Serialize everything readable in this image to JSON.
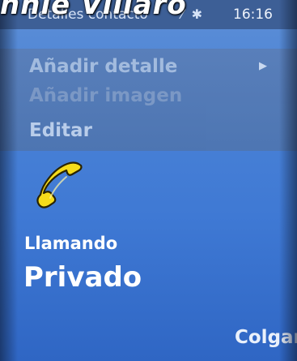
{
  "overlay": {
    "caption": "nnie Villaro"
  },
  "status_bar": {
    "title": "Detalles contacto",
    "time": "16:16",
    "icons": [
      "signal-icon",
      "bluetooth-icon"
    ]
  },
  "options_menu": {
    "items": [
      {
        "label": "Añadir detalle",
        "enabled": true,
        "has_submenu": true
      },
      {
        "label": "Añadir imagen",
        "enabled": false,
        "has_submenu": false
      },
      {
        "label": "Editar",
        "enabled": true,
        "has_submenu": false
      }
    ]
  },
  "call": {
    "status": "Llamando",
    "caller": "Privado",
    "icon": "phone-handset-icon",
    "icon_color": "#f5dc1a"
  },
  "softkeys": {
    "right": "Colgar"
  },
  "colors": {
    "background": "#4a82d6",
    "status_bar": "#3d5f96",
    "menu": "#5a7fb8"
  }
}
